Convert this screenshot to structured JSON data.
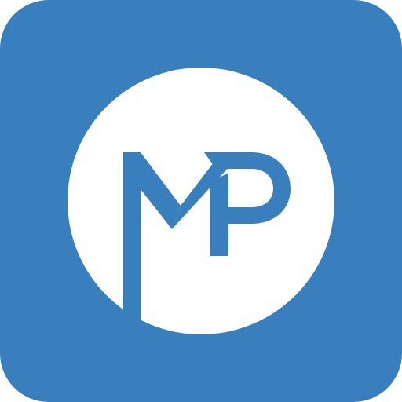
{
  "icon": {
    "monogram": "MP",
    "colors": {
      "background": "#3a7fbd",
      "circle": "#ffffff",
      "letters": "#3a7fbd"
    }
  }
}
